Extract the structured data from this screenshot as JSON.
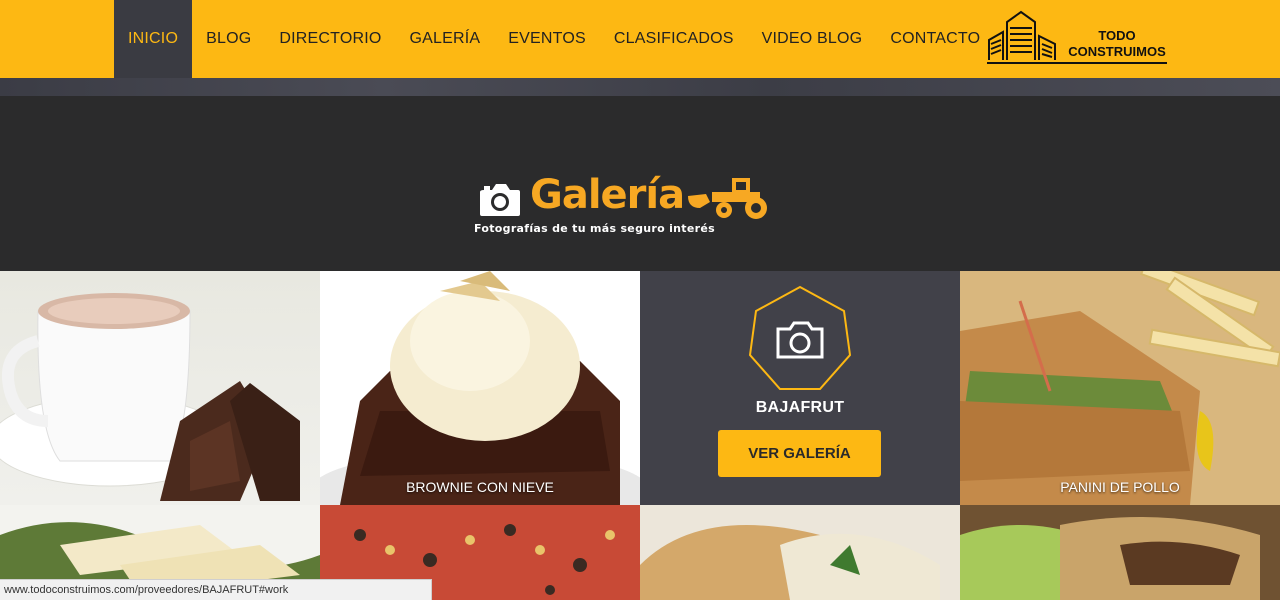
{
  "nav": {
    "items": [
      {
        "label": "INICIO",
        "active": true
      },
      {
        "label": "BLOG"
      },
      {
        "label": "DIRECTORIO"
      },
      {
        "label": "GALERÍA"
      },
      {
        "label": "EVENTOS"
      },
      {
        "label": "CLASIFICADOS"
      },
      {
        "label": "VIDEO BLOG"
      },
      {
        "label": "CONTACTO"
      }
    ]
  },
  "brand": {
    "line1": "TODO",
    "line2": "CONSTRUIMOS",
    "icon": "buildings-icon"
  },
  "banner": {
    "title": "Galería",
    "subtitle": "Fotografías de tu más seguro interés",
    "icons": [
      "camera-icon",
      "tractor-icon"
    ]
  },
  "gallery": {
    "tiles": [
      {
        "caption": ""
      },
      {
        "caption": "BROWNIE CON NIEVE"
      },
      {
        "store": "BAJAFRUT",
        "button": "VER GALERÍA",
        "icon": "camera-icon"
      },
      {
        "caption": "PANINI DE POLLO"
      }
    ]
  },
  "status": {
    "url": "www.todoconstruimos.com/proveedores/BAJAFRUT#work"
  },
  "colors": {
    "accent": "#fdb813",
    "dark": "#2b2b2c",
    "panel": "#414149"
  }
}
